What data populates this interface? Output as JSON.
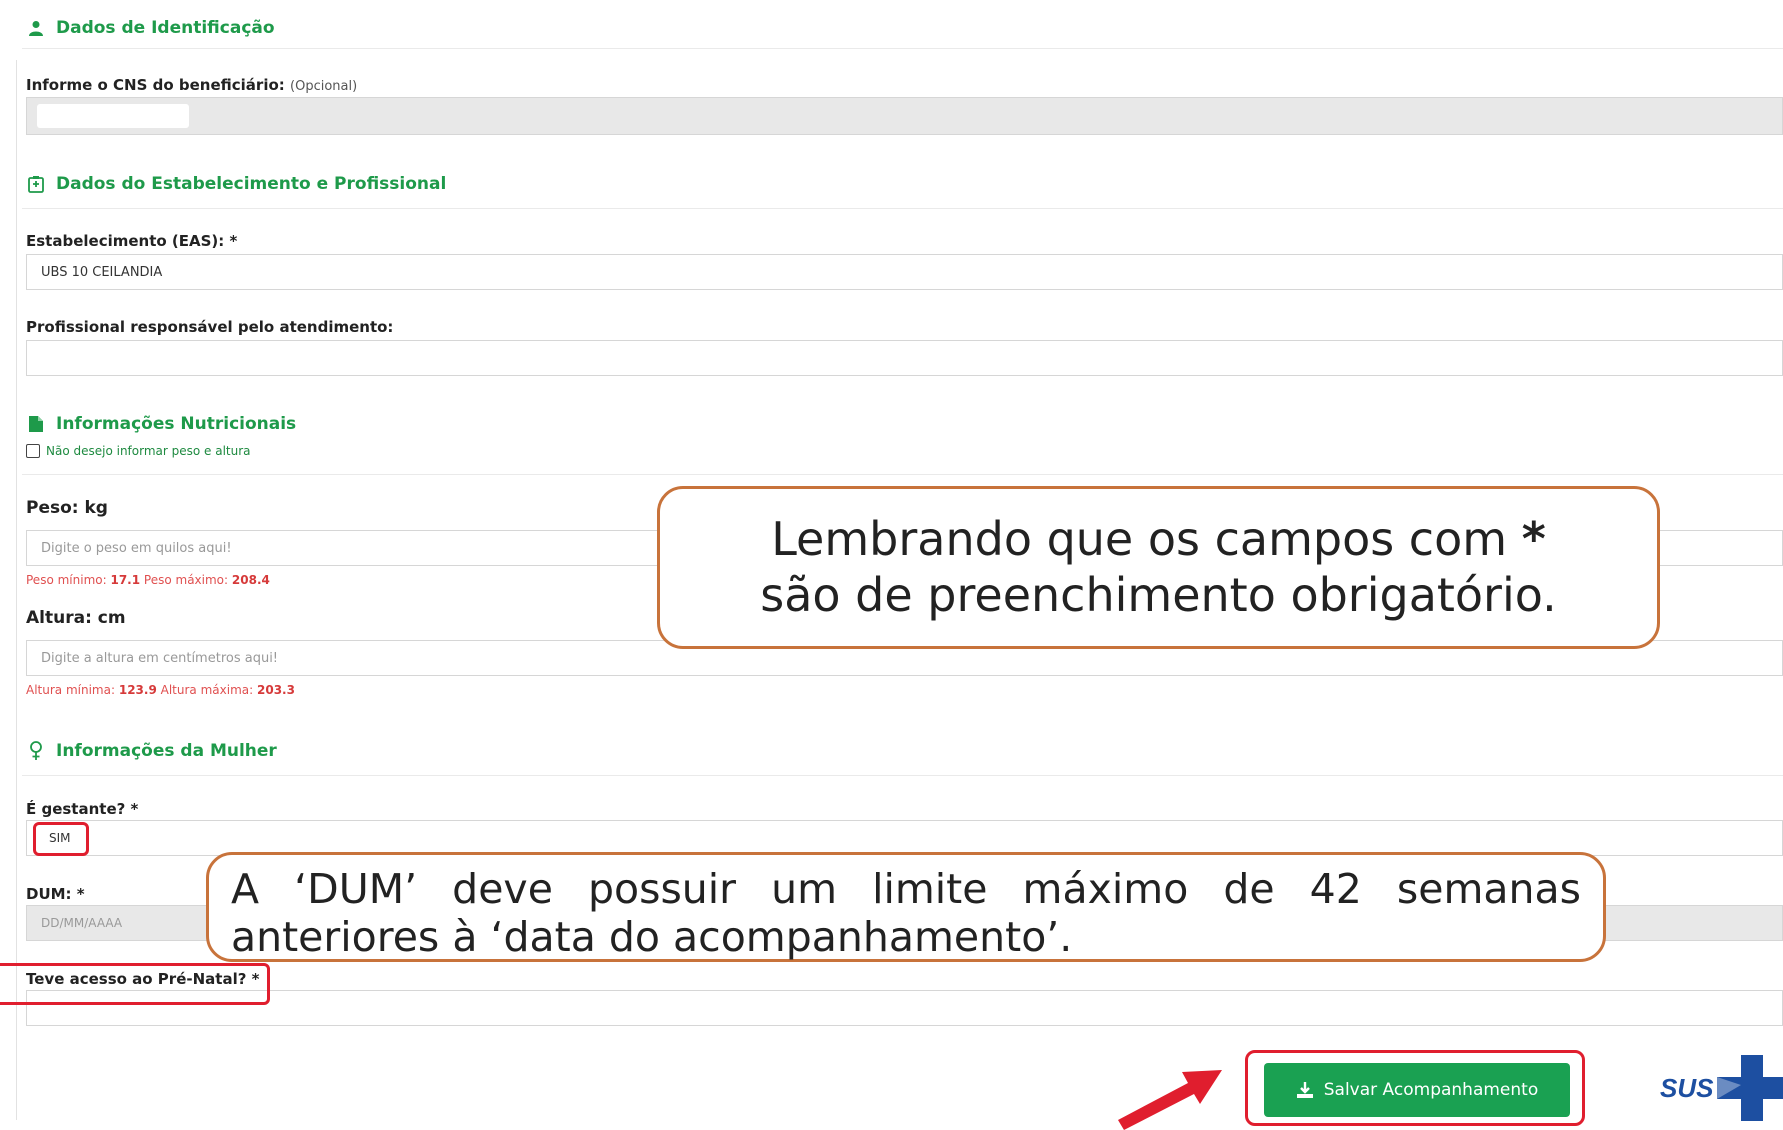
{
  "sections": {
    "identificacao": {
      "title": "Dados de Identificação",
      "icon": "user-icon"
    },
    "estabelecimento": {
      "title": "Dados do Estabelecimento e Profissional",
      "icon": "hospital-icon"
    },
    "nutricionais": {
      "title": "Informações Nutricionais",
      "icon": "file-icon"
    },
    "mulher": {
      "title": "Informações da Mulher",
      "icon": "female-icon"
    }
  },
  "cns": {
    "label": "Informe o CNS do beneficiário:",
    "optional": "(Opcional)",
    "value": ""
  },
  "estabelecimento": {
    "label": "Estabelecimento (EAS): *",
    "value": "UBS 10 CEILANDIA"
  },
  "profissional": {
    "label": "Profissional responsável pelo atendimento:",
    "value": ""
  },
  "nutricional_checkbox": {
    "label": "Não desejo informar peso e altura",
    "checked": false
  },
  "peso": {
    "label": "Peso: kg",
    "placeholder": "Digite o peso em quilos aqui!",
    "min_label": "Peso mínimo:",
    "min": "17.1",
    "max_label": "Peso máximo:",
    "max": "208.4"
  },
  "altura": {
    "label": "Altura: cm",
    "placeholder": "Digite a altura em centímetros aqui!",
    "min_label": "Altura mínima:",
    "min": "123.9",
    "max_label": "Altura máxima:",
    "max": "203.3"
  },
  "gestante": {
    "label": "É gestante? *",
    "value": "SIM"
  },
  "dum": {
    "label": "DUM: *",
    "placeholder": "DD/MM/AAAA"
  },
  "prenatal": {
    "label": "Teve acesso ao Pré-Natal? *",
    "value": ""
  },
  "callouts": {
    "required_line1": "Lembrando que os campos com ",
    "required_star": "*",
    "required_line2": "são de preenchimento obrigatório.",
    "dum_text": "A ‘DUM’ deve possuir um limite máximo de 42 semanas anteriores à ‘data do acompanhamento’."
  },
  "actions": {
    "save_label": "Salvar Acompanhamento",
    "save_icon": "download-icon"
  },
  "logo": {
    "text": "SUS"
  },
  "colors": {
    "brand_green": "#1e9a4a",
    "button_green": "#1aa152",
    "highlight_red": "#e01e2e",
    "callout_border": "#c8733b",
    "hint_red": "#e05050"
  }
}
